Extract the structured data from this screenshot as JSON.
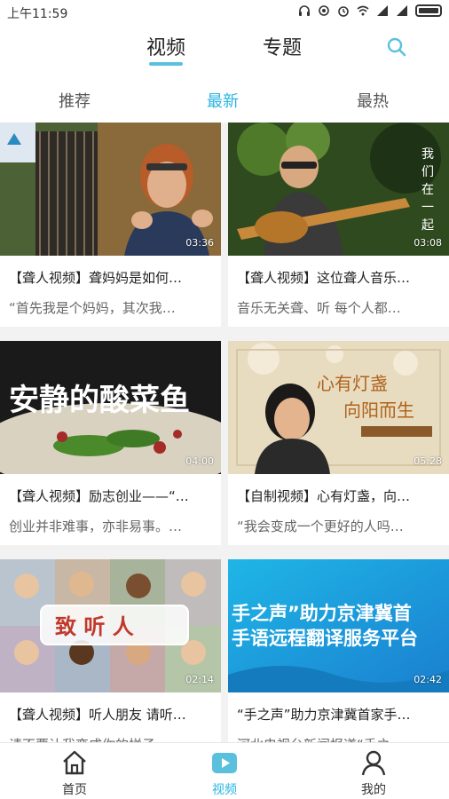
{
  "status_bar": {
    "time": "上午11:59"
  },
  "header": {
    "tabs": [
      {
        "label": "视频",
        "active": true
      },
      {
        "label": "专题",
        "active": false
      }
    ],
    "accent_color": "#5bc0de"
  },
  "subtabs": [
    {
      "label": "推荐",
      "active": false
    },
    {
      "label": "最新",
      "active": true
    },
    {
      "label": "最热",
      "active": false
    }
  ],
  "videos": [
    {
      "title": "【聋人视频】聋妈妈是如何…",
      "desc": "“首先我是个妈妈，其次我…",
      "duration": "03:36"
    },
    {
      "title": "【聋人视频】这位聋人音乐…",
      "desc": "音乐无关聋、听 每个人都…",
      "duration": "03:08",
      "overlay_text": "我们在一起"
    },
    {
      "title": "【聋人视频】励志创业——“…",
      "desc": "创业并非难事，亦非易事。…",
      "duration": "04:00",
      "overlay_text": "安静的酸菜鱼"
    },
    {
      "title": "【自制视频】心有灯盏，向…",
      "desc": "“我会变成一个更好的人吗…",
      "duration": "05:28",
      "overlay_text": "心有灯盏 向阳而生"
    },
    {
      "title": "【聋人视频】听人朋友 请听…",
      "desc": "请不要让我变成你的样子…",
      "duration": "02:14",
      "overlay_text": "致 听 人"
    },
    {
      "title": "“手之声”助力京津冀首家手…",
      "desc": "河北电视台新闻报道“手之…",
      "duration": "02:42",
      "overlay_text": "手之声”助力京津冀首 手语远程翻译服务平台"
    }
  ],
  "bottom_nav": [
    {
      "label": "首页",
      "icon": "home-icon",
      "active": false
    },
    {
      "label": "视频",
      "icon": "video-icon",
      "active": true
    },
    {
      "label": "我的",
      "icon": "user-icon",
      "active": false
    }
  ]
}
